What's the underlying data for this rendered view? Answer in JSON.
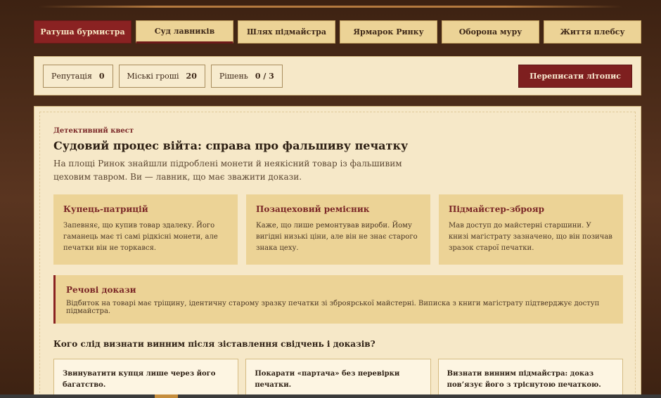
{
  "tabs": [
    {
      "label": "Ратуша бурмистра"
    },
    {
      "label": "Суд лавників"
    },
    {
      "label": "Шлях підмайстра"
    },
    {
      "label": "Ярмарок Ринку"
    },
    {
      "label": "Оборона муру"
    },
    {
      "label": "Життя плебсу"
    }
  ],
  "status": {
    "reputation_label": "Репутація",
    "reputation_value": "0",
    "money_label": "Міські гроші",
    "money_value": "20",
    "decisions_label": "Рішень",
    "decisions_value": "0 / 3",
    "rewrite_label": "Переписати літопис"
  },
  "quest": {
    "kicker": "Детективний квест",
    "title": "Судовий процес війта: справа про фальшиву печатку",
    "description": "На площі Ринок знайшли підроблені монети й неякісний товар із фальшивим цеховим тавром. Ви — лавник, що має зважити докази."
  },
  "suspects": [
    {
      "name": "Купець-патрицій",
      "text": "Запевняє, що купив товар здалеку. Його гаманець має ті самі рідкісні монети, але печатки він не торкався."
    },
    {
      "name": "Позацеховий ремісник",
      "text": "Каже, що лише ремонтував вироби. Йому вигідні низькі ціни, але він не знає старого знака цеху."
    },
    {
      "name": "Підмайстер-зброяр",
      "text": "Мав доступ до майстерні старшини. У книзі магістрату зазначено, що він позичав зразок старої печатки."
    }
  ],
  "evidence": {
    "title": "Речові докази",
    "text": "Відбиток на товарі має тріщину, ідентичну старому зразку печатки зі зброярської майстерні. Виписка з книги магістрату підтверджує доступ підмайстра."
  },
  "question": "Кого слід визнати винним після зіставлення свідчень і доказів?",
  "answers": [
    {
      "label": "Звинуватити купця лише через його багатство."
    },
    {
      "label": "Покарати «партача» без перевірки печатки."
    },
    {
      "label": "Визнати винним підмайстра: доказ пов’язує його з тріснутою печаткою."
    }
  ],
  "colors": {
    "accent": "#8a2222",
    "parchment": "#f6e8c8",
    "card": "#ecd396",
    "wood": "#4a2a17"
  }
}
